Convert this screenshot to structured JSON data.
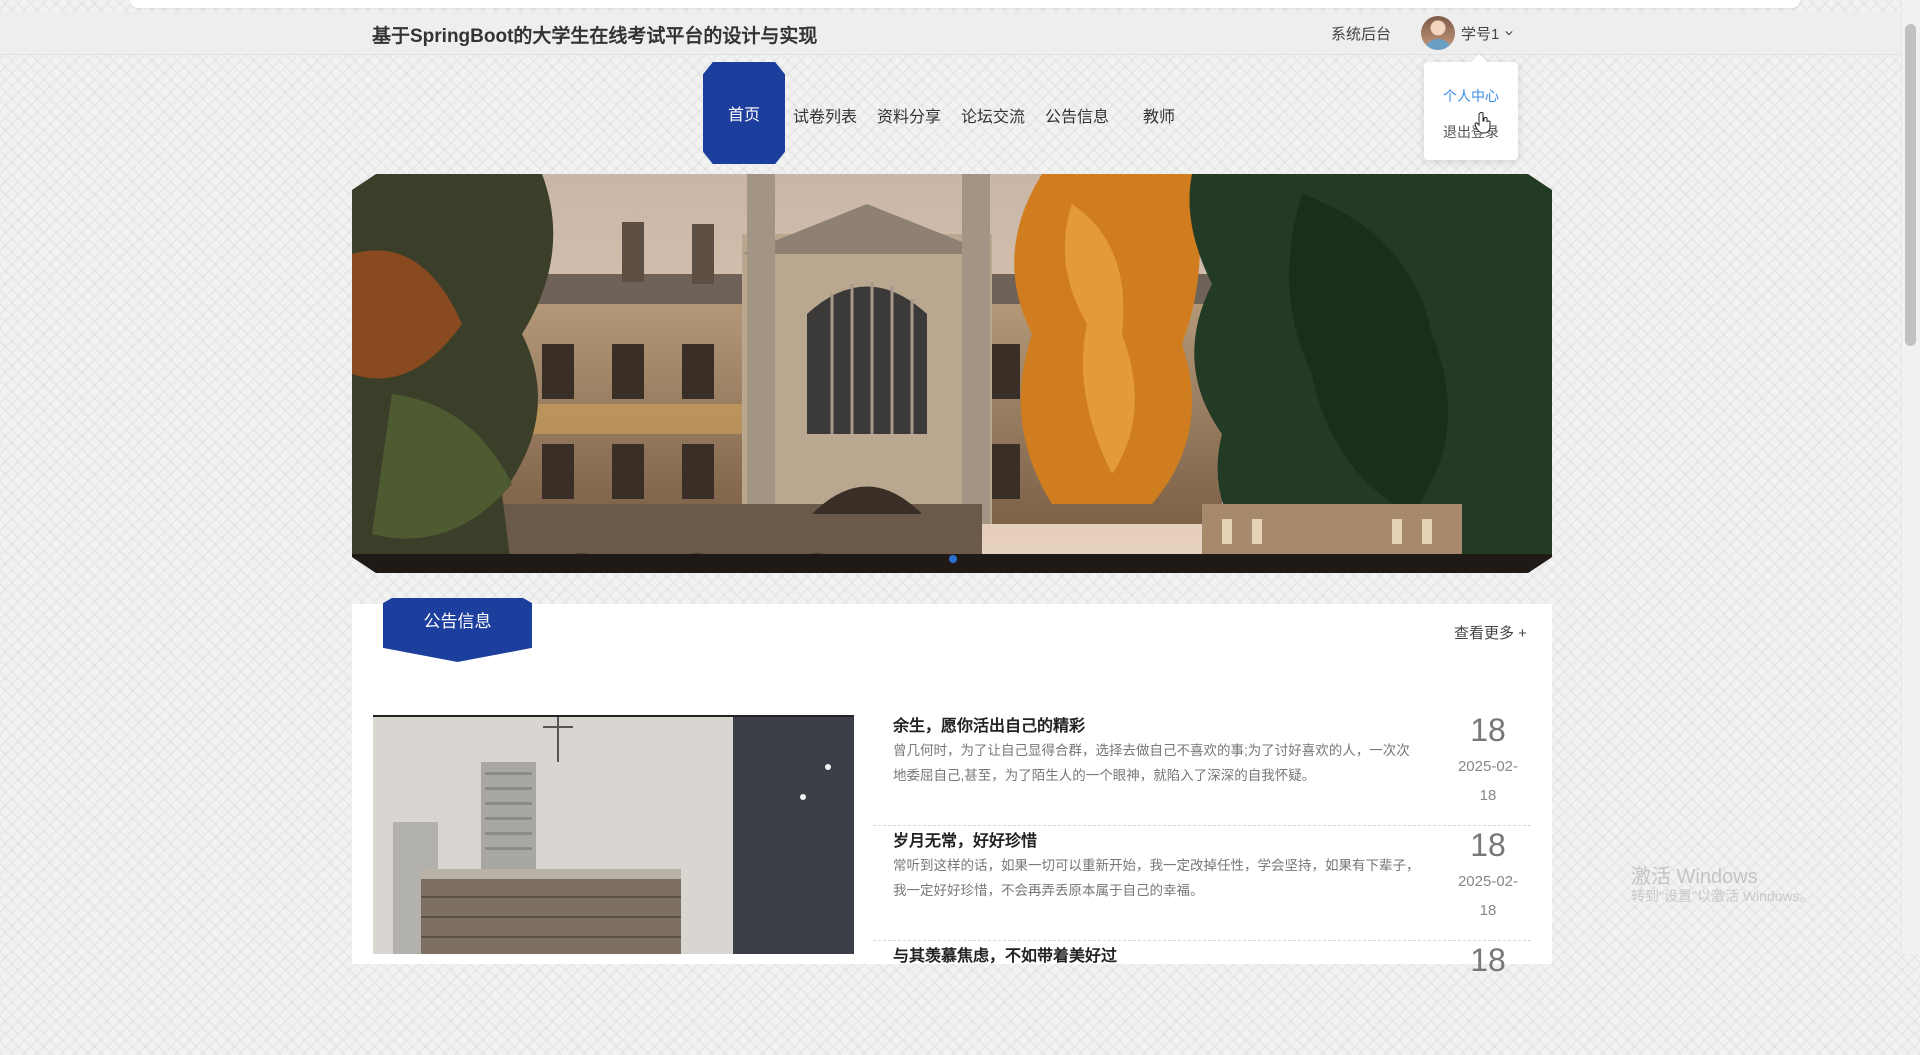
{
  "header": {
    "site_title": "基于SpringBoot的大学生在线考试平台的设计与实现",
    "admin_link": "系统后台",
    "user_name": "学号1"
  },
  "user_menu": {
    "items": [
      "个人中心",
      "退出登录"
    ]
  },
  "nav": {
    "items": [
      "首页",
      "试卷列表",
      "资料分享",
      "论坛交流",
      "公告信息",
      "教师"
    ],
    "active": "首页"
  },
  "notice_section": {
    "title": "公告信息",
    "more_label": "查看更多 +",
    "items": [
      {
        "title": "余生，愿你活出自己的精彩",
        "desc": "曾几何时，为了让自己显得合群，选择去做自己不喜欢的事;为了讨好喜欢的人，一次次地委屈自己,甚至，为了陌生人的一个眼神，就陷入了深深的自我怀疑。",
        "day": "18",
        "date": "2025-02-18"
      },
      {
        "title": "岁月无常，好好珍惜",
        "desc": "常听到这样的话，如果一切可以重新开始，我一定改掉任性，学会坚持，如果有下辈子，我一定好好珍惜，不会再弄丢原本属于自己的幸福。",
        "day": "18",
        "date": "2025-02-18"
      },
      {
        "title": "与其羡慕焦虑，不如带着美好过",
        "desc": "",
        "day": "18",
        "date": ""
      }
    ]
  },
  "watermark": {
    "line1": "激活 Windows",
    "line2": "转到\"设置\"以激活 Windows。"
  },
  "colors": {
    "primary": "#1c3f9e",
    "link_active": "#3a8ee6"
  }
}
